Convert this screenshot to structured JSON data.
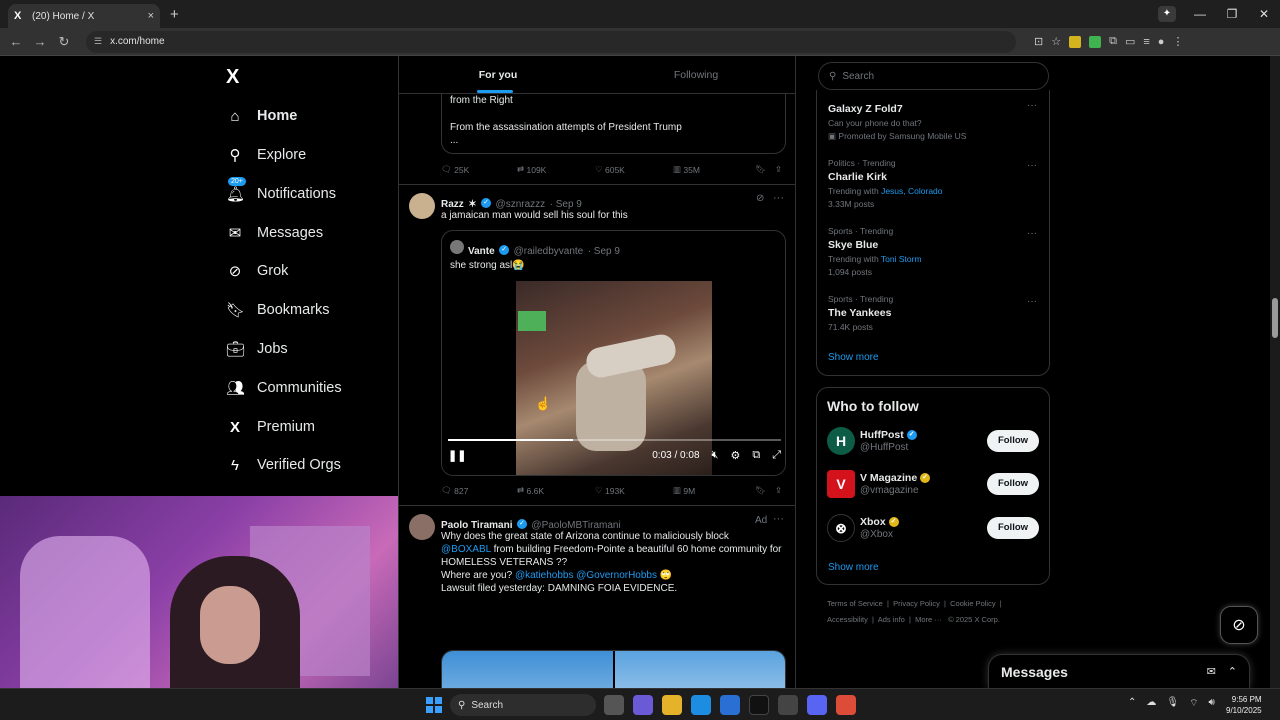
{
  "browser": {
    "tab_title": "(20) Home / X",
    "tab_favicon": "X",
    "tab_close": "×",
    "new_tab": "+",
    "url": "x.com/home",
    "win_min": "—",
    "win_max": "❐",
    "win_close": "✕"
  },
  "nav": {
    "logo": "X",
    "notif_badge": "20+",
    "items": [
      {
        "label": "Home",
        "icon": "home-icon"
      },
      {
        "label": "Explore",
        "icon": "search-icon"
      },
      {
        "label": "Notifications",
        "icon": "bell-icon"
      },
      {
        "label": "Messages",
        "icon": "envelope-icon"
      },
      {
        "label": "Grok",
        "icon": "grok-icon"
      },
      {
        "label": "Bookmarks",
        "icon": "bookmark-icon"
      },
      {
        "label": "Jobs",
        "icon": "briefcase-icon"
      },
      {
        "label": "Communities",
        "icon": "people-icon"
      },
      {
        "label": "Premium",
        "icon": "x-logo-icon"
      },
      {
        "label": "Verified Orgs",
        "icon": "lightning-icon"
      }
    ]
  },
  "feed": {
    "tabs": [
      "For you",
      "Following"
    ],
    "post1": {
      "line1": "from the Right",
      "line2": "From the assassination attempts of President Trump",
      "line3": "...",
      "replies": "25K",
      "reposts": "109K",
      "likes": "605K",
      "views": "35M"
    },
    "post2": {
      "name": "Razz",
      "name_emoji": "✶",
      "handle": "@sznrazzz",
      "time": "· Sep 9",
      "text": "a jamaican man would sell his soul for this",
      "quote": {
        "name": "Vante",
        "handle": "@railedbyvante",
        "time": "· Sep 9",
        "text": "she strong asl😭"
      },
      "video_time": "0:03 / 0:08",
      "video_progress": 0.375,
      "replies": "827",
      "reposts": "6.6K",
      "likes": "193K",
      "views": "9M"
    },
    "post3": {
      "name": "Paolo Tiramani",
      "handle": "@PaoloMBTiramani",
      "ad_label": "Ad",
      "text_a": "Why does the great state of Arizona continue to maliciously block",
      "mention1": "@BOXABL",
      "text_b": " from building Freedom-Pointe a beautiful 60 home community for HOMELESS VETERANS ??",
      "text_c": "Where are you? ",
      "mention2": "@katiehobbs",
      "mention3": " @GovernorHobbs",
      "text_d": " 🙄",
      "text_e": "Lawsuit filed yesterday: DAMNING FOIA EVIDENCE."
    }
  },
  "sidebar": {
    "search_placeholder": "Search",
    "trends": [
      {
        "meta": "",
        "title": "Galaxy Z Fold7",
        "sub": "Can your phone do that?",
        "sub2": "Promoted by Samsung Mobile US"
      },
      {
        "meta": "Politics · Trending",
        "title": "Charlie Kirk",
        "sub_prefix": "Trending with ",
        "sub_link": "Jesus, Colorado",
        "count": "3.33M posts"
      },
      {
        "meta": "Sports · Trending",
        "title": "Skye Blue",
        "sub_prefix": "Trending with ",
        "sub_link": "Toni Storm",
        "count": "1,094 posts"
      },
      {
        "meta": "Sports · Trending",
        "title": "The Yankees",
        "count": "71.4K posts"
      }
    ],
    "show_more": "Show more",
    "who_to_follow": "Who to follow",
    "follows": [
      {
        "name": "HuffPost",
        "handle": "@HuffPost",
        "btn": "Follow"
      },
      {
        "name": "V Magazine",
        "handle": "@vmagazine",
        "btn": "Follow"
      },
      {
        "name": "Xbox",
        "handle": "@Xbox",
        "btn": "Follow"
      }
    ],
    "show_more2": "Show more",
    "footer": [
      "Terms of Service",
      "Privacy Policy",
      "Cookie Policy",
      "Accessibility",
      "Ads info",
      "More ···",
      "© 2025 X Corp."
    ]
  },
  "messages_drawer": {
    "title": "Messages"
  },
  "taskbar": {
    "search": "Search",
    "time": "9:56 PM",
    "date": "9/10/2025"
  },
  "colors": {
    "accent": "#1d9bf0",
    "bg": "#000000",
    "border": "#2f3336"
  }
}
